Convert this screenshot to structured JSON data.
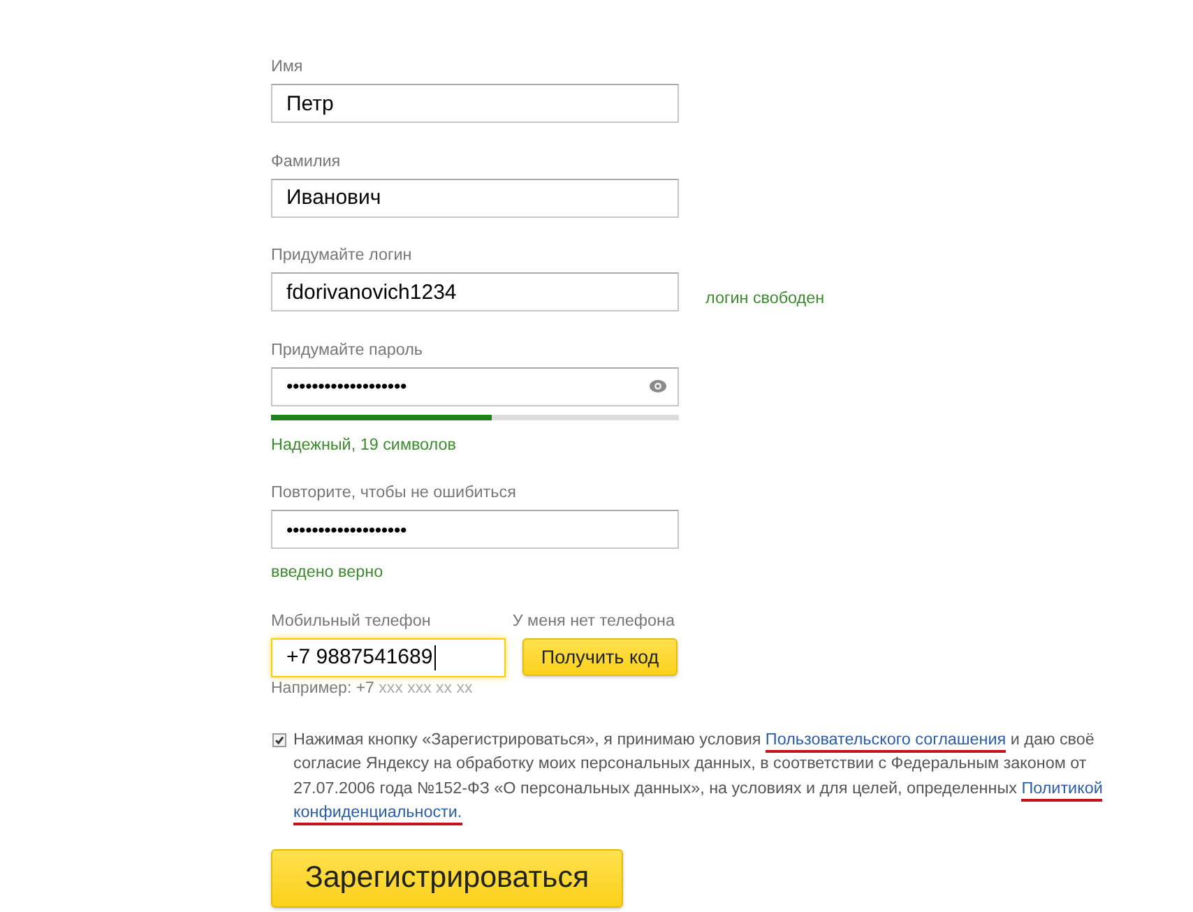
{
  "fields": [
    {
      "kind": "text",
      "label": "Имя",
      "value": "Петр"
    },
    {
      "kind": "text",
      "label": "Фамилия",
      "value": "Иванович"
    },
    {
      "kind": "login",
      "label": "Придумайте логин",
      "value": "fdorivanovich1234",
      "status": {
        "text": "логин свободен",
        "valid": true
      }
    },
    {
      "kind": "password",
      "label": "Придумайте пароль",
      "value": "•••••••••••••••••••",
      "strength": {
        "level": 0.54,
        "text": "Надежный, 19 символов",
        "valid": true
      }
    },
    {
      "kind": "repeat",
      "label": "Повторите, чтобы не ошибиться",
      "value": "•••••••••••••••••••",
      "status": {
        "text": "введено верно",
        "valid": true
      }
    }
  ],
  "phone": {
    "label": "Мобильный телефон",
    "no_phone_link": "У меня нет телефона",
    "value": "+7 9887541689",
    "focused": true,
    "button": "Получить код",
    "hint": {
      "prefix": "Например: +7",
      "mask": "xxx xxx xx xx"
    }
  },
  "agreement": {
    "checked": true,
    "segments": [
      {
        "kind": "text",
        "text": "Нажимая кнопку «Зарегистрироваться», я принимаю условия "
      },
      {
        "kind": "link",
        "text": "Пользовательского соглашения",
        "marked": true
      },
      {
        "kind": "text",
        "text": " и даю своё согласие Яндексу на обработку моих персональных данных, в соответствии с Федеральным законом от 27.07.2006 года №152-ФЗ «О персональных данных», на условиях и для целей, определенных "
      },
      {
        "kind": "link",
        "text": "Политикой",
        "marked": true
      },
      {
        "kind": "link",
        "text": "конфиденциальности.",
        "marked": true
      }
    ]
  },
  "submit": "Зарегистрироваться"
}
